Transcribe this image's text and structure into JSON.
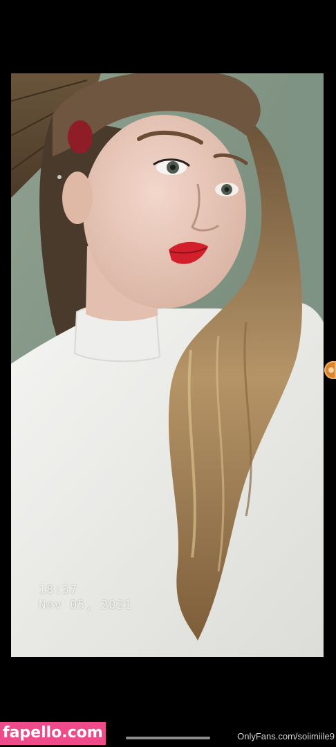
{
  "photo": {
    "alt": "Selfie of a woman with long wavy blonde hair, red lipstick and a white mock-neck top",
    "timestamp_time": "18:37",
    "timestamp_date": "Nov 05, 2021"
  },
  "footer": {
    "site_badge": "fapello.com",
    "creator_link": "OnlyFans.com/soiimiile9"
  },
  "colors": {
    "badge_bg": "#ef4b8a",
    "background": "#000000",
    "handle": "#d9832c"
  }
}
